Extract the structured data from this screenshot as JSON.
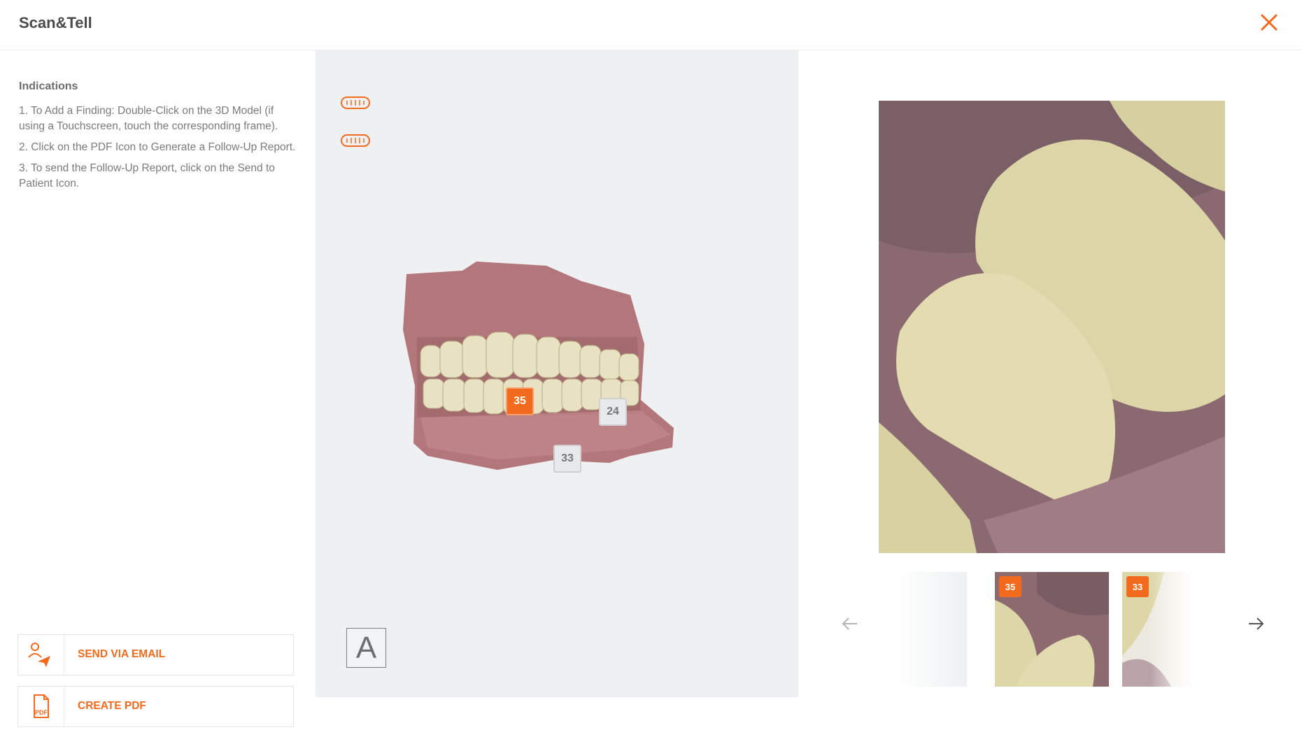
{
  "app": {
    "title": "Scan&Tell"
  },
  "indications": {
    "title": "Indications",
    "items": [
      "1. To Add a Finding: Double-Click on the 3D Model (if using a Touchscreen, touch the corresponding frame).",
      "2. Click on the PDF Icon to Generate a Follow-Up Report.",
      "3. To send the Follow-Up Report, click on the Send to Patient Icon."
    ]
  },
  "actions": {
    "email_label": "SEND VIA EMAIL",
    "pdf_label": "CREATE PDF",
    "pdf_icon_text": "PDF"
  },
  "viewer": {
    "markers": [
      {
        "id": "35",
        "label": "35",
        "active": true
      },
      {
        "id": "24",
        "label": "24",
        "active": false
      },
      {
        "id": "33",
        "label": "33",
        "active": false
      }
    ],
    "annotation_button": "A"
  },
  "gallery": {
    "thumbnails": [
      {
        "badge": ""
      },
      {
        "badge": "35"
      },
      {
        "badge": "33"
      }
    ]
  },
  "colors": {
    "accent": "#f26a1e",
    "viewer_bg": "#eff0f2",
    "text_muted": "#7b7b7b"
  }
}
